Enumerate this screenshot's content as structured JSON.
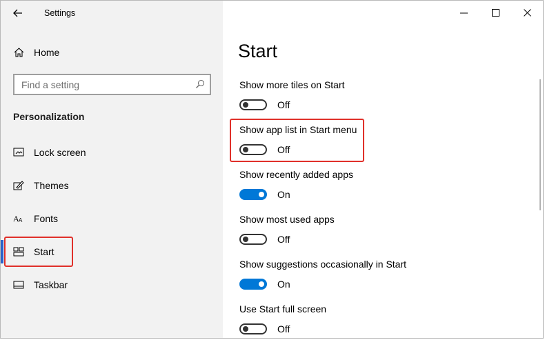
{
  "app": {
    "title": "Settings"
  },
  "sidebar": {
    "home_label": "Home",
    "search_placeholder": "Find a setting",
    "section_title": "Personalization",
    "items": [
      {
        "label": "Lock screen",
        "icon": "lock-screen-icon"
      },
      {
        "label": "Themes",
        "icon": "themes-icon"
      },
      {
        "label": "Fonts",
        "icon": "fonts-icon"
      },
      {
        "label": "Start",
        "icon": "start-icon",
        "selected": true
      },
      {
        "label": "Taskbar",
        "icon": "taskbar-icon"
      }
    ]
  },
  "window_controls": [
    "minimize",
    "maximize",
    "close"
  ],
  "page": {
    "title": "Start",
    "settings": [
      {
        "label": "Show more tiles on Start",
        "state": "Off"
      },
      {
        "label": "Show app list in Start menu",
        "state": "Off"
      },
      {
        "label": "Show recently added apps",
        "state": "On"
      },
      {
        "label": "Show most used apps",
        "state": "Off"
      },
      {
        "label": "Show suggestions occasionally in Start",
        "state": "On"
      },
      {
        "label": "Use Start full screen",
        "state": "Off"
      }
    ]
  },
  "colors": {
    "sidebar_bg": "#f2f2f2",
    "accent": "#0078d7",
    "selection_bar": "#2a62c9",
    "highlight": "#e0302a"
  }
}
